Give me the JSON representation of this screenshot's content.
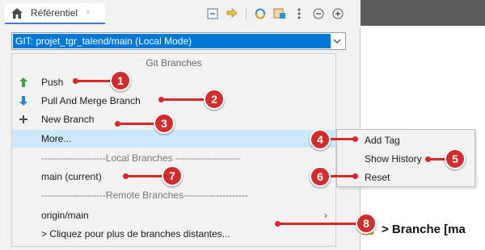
{
  "tab": {
    "label": "Référentiel",
    "close": "×"
  },
  "combo": {
    "value": "GIT: projet_tgr_talend/main   (Local Mode)"
  },
  "menu": {
    "header": "Git Branches",
    "items": [
      {
        "label": "Push",
        "icon": "arrow-up-icon"
      },
      {
        "label": "Pull And Merge Branch",
        "icon": "arrow-down-icon"
      },
      {
        "label": "New Branch",
        "icon": "plus-icon"
      },
      {
        "label": "More..."
      }
    ],
    "local_sep": "--------------------Local   Branches --------------------",
    "local_branch": "main (current)",
    "remote_sep": "--------------------Remote Branches--------------------",
    "remote_branch": "origin/main",
    "more_remote": "> Cliquez pour plus de branches distantes..."
  },
  "submenu": {
    "items": [
      "Add Tag",
      "Show History",
      "Reset"
    ]
  },
  "branch_title": "> Branche [ma",
  "callouts": [
    "1",
    "2",
    "3",
    "4",
    "5",
    "6",
    "7",
    "8"
  ],
  "colors": {
    "selection": "#0078d7",
    "highlight": "#cde8fb",
    "callout": "#d22c2c",
    "push_icon": "#3ea33e",
    "pull_icon": "#1e86d6"
  }
}
